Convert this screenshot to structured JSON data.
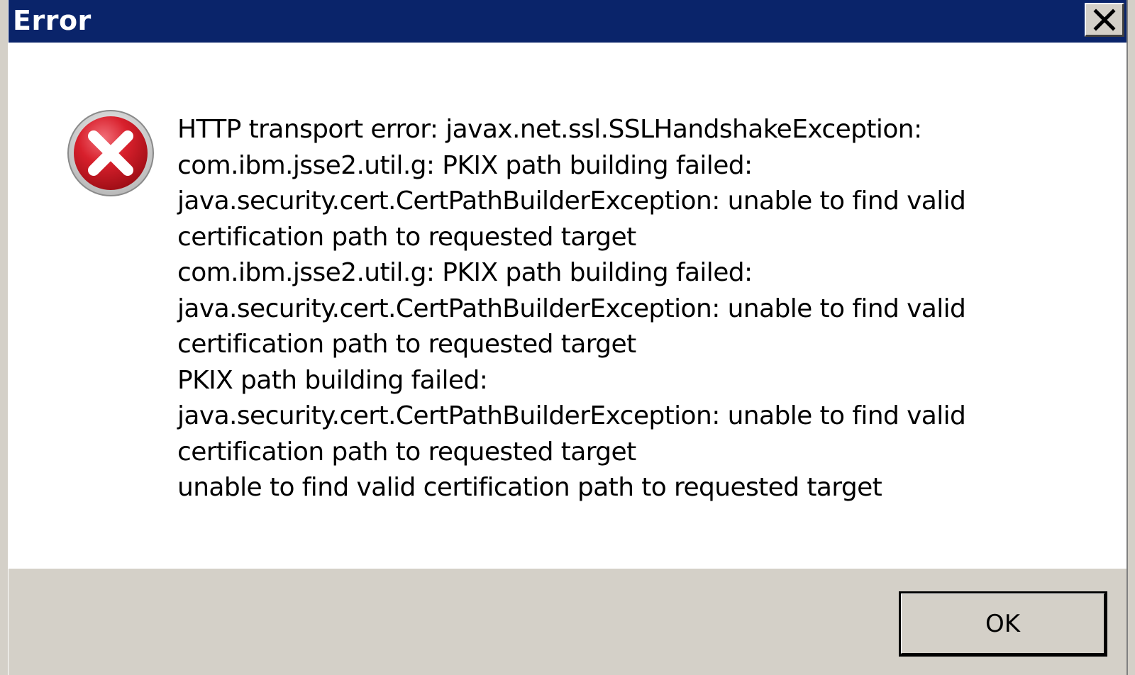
{
  "window": {
    "title": "Error",
    "close_icon": "close-icon"
  },
  "dialog": {
    "icon": "error-icon",
    "message_lines": [
      "HTTP transport error: javax.net.ssl.SSLHandshakeException:",
      "com.ibm.jsse2.util.g: PKIX path building failed:",
      "java.security.cert.CertPathBuilderException: unable to find valid",
      "certification path to requested target",
      "com.ibm.jsse2.util.g: PKIX path building failed:",
      "java.security.cert.CertPathBuilderException: unable to find valid",
      "certification path to requested target",
      "PKIX path building failed:",
      "java.security.cert.CertPathBuilderException: unable to find valid",
      "certification path to requested target",
      "unable to find valid certification path to requested target"
    ]
  },
  "buttons": {
    "ok_label": "OK"
  },
  "colors": {
    "titlebar": "#0a246a",
    "face": "#d4d0c8",
    "error_red": "#c8101c"
  }
}
